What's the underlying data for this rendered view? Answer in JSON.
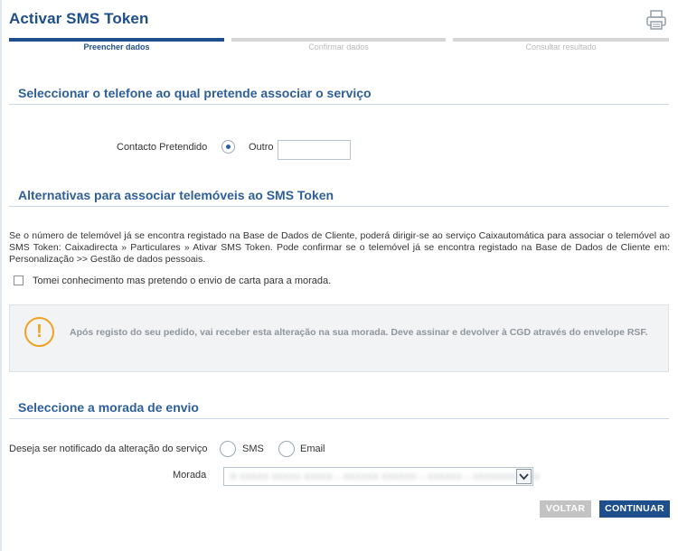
{
  "page": {
    "title": "Activar SMS Token"
  },
  "toolbar": {
    "print_icon": "printer-icon"
  },
  "steps": [
    {
      "label": "Preencher dados",
      "active": true
    },
    {
      "label": "Confirmar dados",
      "active": false
    },
    {
      "label": "Consultar resultado",
      "active": false
    }
  ],
  "section_phone": {
    "title": "Seleccionar o telefone ao qual pretende associar o serviço",
    "contact_label": "Contacto Pretendido",
    "option_other": "Outro",
    "other_value": "",
    "other_selected": true
  },
  "section_alternatives": {
    "title": "Alternativas para associar telemóveis ao SMS Token",
    "paragraph": "Se o número de telemóvel já se encontra registado na Base de Dados de Cliente, poderá dirigir-se ao serviço Caixautomática para associar o telemóvel ao SMS Token: Caixadirecta » Particulares » Ativar SMS Token. Pode confirmar se o telemóvel já se encontra registado na Base de Dados de Cliente em: Personalização >> Gestão de dados pessoais.",
    "checkbox_label": "Tomei conhecimento mas pretendo o envio de carta para a morada.",
    "checkbox_checked": false
  },
  "notice": {
    "icon": "warning-icon",
    "icon_glyph": "!",
    "text": "Após registo do seu pedido, vai receber esta alteração na sua morada. Deve assinar e devolver à CGD através do envelope RSF."
  },
  "section_address": {
    "title": "Seleccione a morada de envio",
    "notify_label": "Deseja ser notificado da alteração do serviço",
    "option_sms": "SMS",
    "option_email": "Email",
    "address_label": "Morada",
    "address_value": "R XXXXX XXXXX XXXXX – XXXXXX XXXXXX – XXXXXX – XXXXXXXX XXX"
  },
  "actions": {
    "back_label": "VOLTAR",
    "continue_label": "CONTINUAR"
  },
  "colors": {
    "brand": "#1f4e8c",
    "section_title": "#2e5f99",
    "warning": "#f0a21e",
    "disabled": "#c3c3c3"
  }
}
